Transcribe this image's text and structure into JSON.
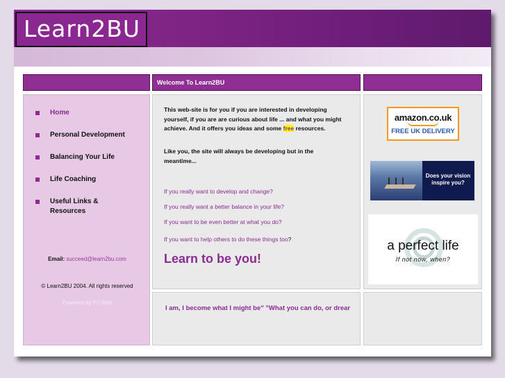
{
  "header": {
    "logo_text": "Learn2BU"
  },
  "bars": {
    "main_title": "Welcome To Learn2BU"
  },
  "nav": {
    "items": [
      {
        "label": "Home",
        "active": true
      },
      {
        "label": "Personal Development",
        "active": false
      },
      {
        "label": "Balancing Your Life",
        "active": false
      },
      {
        "label": "Life Coaching",
        "active": false
      },
      {
        "label": "Useful Links & Resources",
        "active": false
      }
    ]
  },
  "sidebar": {
    "email_label": "Email:",
    "email_address": "succeed@learn2bu.com",
    "copyright": "© Learn2BU 2004. All rights reserved",
    "powered_by": "Powered by PJ Web"
  },
  "main": {
    "intro_1_pre": "This web-site is for you if you are interested in developing yourself, if you are are curious about life ... and what you might achieve. And it offers you ideas and some ",
    "intro_1_highlight": "free",
    "intro_1_post": " resources.",
    "intro_2": "Like you, the site will always be developing but in the meantime...",
    "questions": [
      "If you really want to develop and change?",
      "If you really want a better balance in your life?",
      "If you want to be even better at what you do?",
      "If you want to help others to do these things too"
    ],
    "question_mark": "?",
    "tagline": "Learn to be you!",
    "ticker": "I am, I become what I might be\"   \"What you can do, or dream you can, begin it\""
  },
  "ads": {
    "amazon_brand": "amazon.co.uk",
    "amazon_offer": "FREE UK DELIVERY",
    "vision_text": "Does your vision inspire you?",
    "perfect_title": "a perfect life",
    "perfect_sub": "If not now, when?"
  },
  "colors": {
    "brand_purple": "#8a2c90",
    "sidebar_bg": "#e7c9e6",
    "panel_bg": "#eaeaea",
    "highlight": "#ffff00"
  }
}
